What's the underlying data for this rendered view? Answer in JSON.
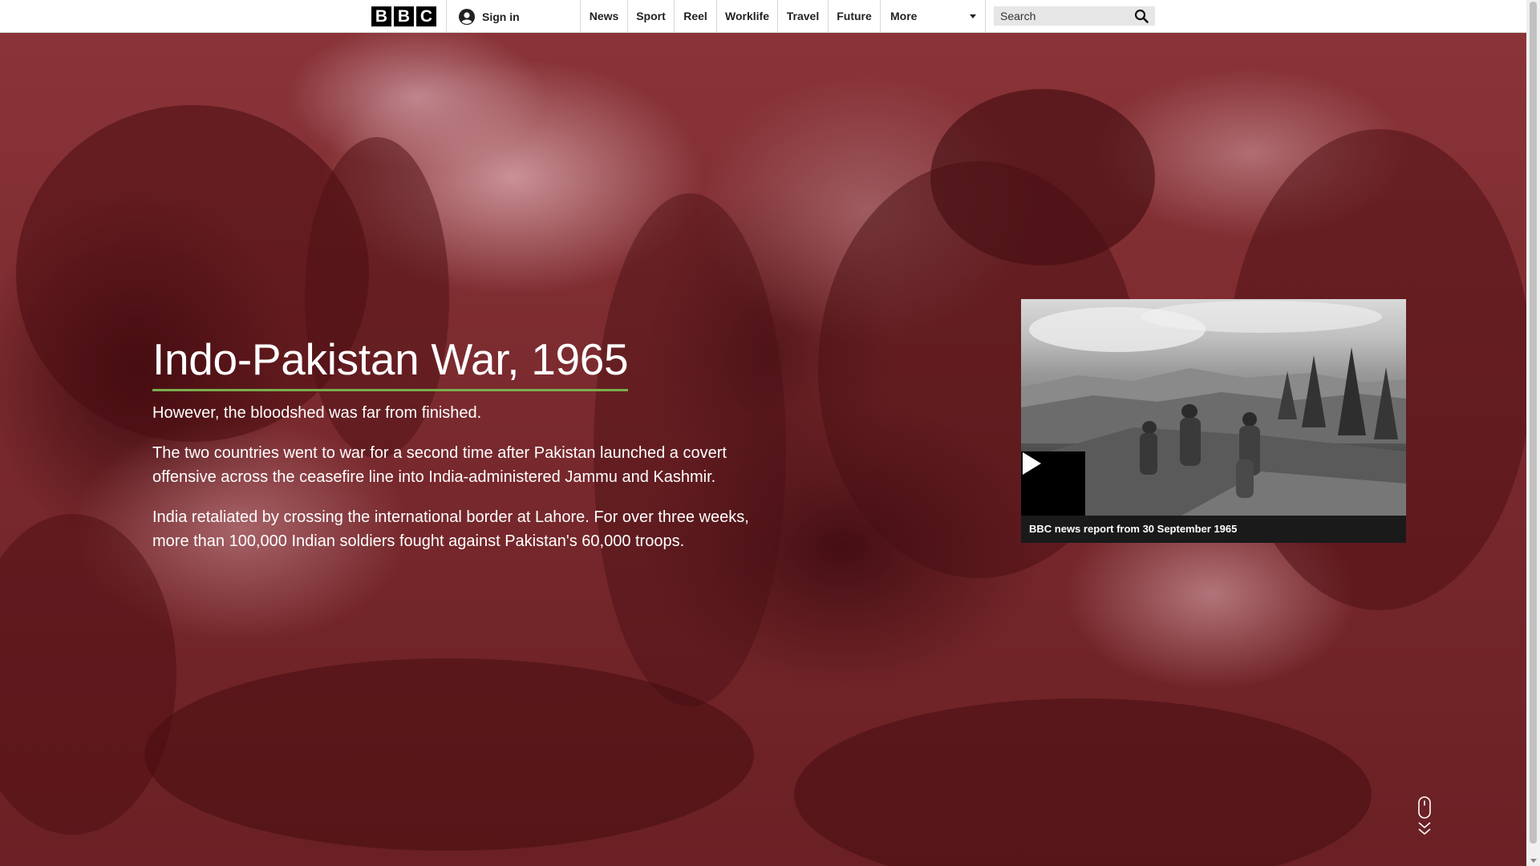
{
  "brand": {
    "letters": [
      "B",
      "B",
      "C"
    ]
  },
  "account": {
    "sign_in_label": "Sign in",
    "icon": "user-icon"
  },
  "nav": {
    "items": [
      {
        "label": "News"
      },
      {
        "label": "Sport"
      },
      {
        "label": "Reel"
      },
      {
        "label": "Worklife"
      },
      {
        "label": "Travel"
      },
      {
        "label": "Future"
      },
      {
        "label": "More"
      }
    ]
  },
  "search": {
    "placeholder": "Search",
    "icon": "search-icon"
  },
  "hero": {
    "title": "Indo-Pakistan War, 1965",
    "intro": "However, the bloodshed was far from finished.",
    "paragraphs": [
      "The two countries went to war for a second time after Pakistan launched a covert offensive across the ceasefire line into India-administered Jammu and Kashmir.",
      "India retaliated by crossing the international border at Lahore. For over three weeks, more than 100,000 Indian soldiers fought against Pakistan's 60,000 troops."
    ]
  },
  "video": {
    "caption": "BBC news report from 30 September 1965",
    "icon": "play-icon"
  },
  "colors": {
    "title_underline": "#7bad4d",
    "hero_tint": "#7a2a2e"
  }
}
